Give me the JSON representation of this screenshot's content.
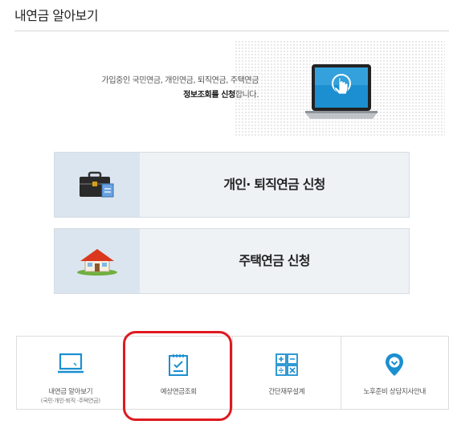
{
  "page": {
    "title": "내연금 알아보기"
  },
  "intro": {
    "line1": "가입중인 국민연금, 개인연금, 퇴직연금, 주택연금",
    "line2_bold": "정보조회를 신청",
    "line2_rest": "합니다."
  },
  "apply_buttons": [
    {
      "label": "개인· 퇴직연금 신청",
      "icon": "briefcase-icon"
    },
    {
      "label": "주택연금 신청",
      "icon": "house-icon"
    }
  ],
  "menu": [
    {
      "label": "내연금 알아보기",
      "sub": "(국민·개인·퇴직 ·주택연금)",
      "icon": "laptop-icon"
    },
    {
      "label": "예상연금조회",
      "sub": "",
      "icon": "checklist-icon"
    },
    {
      "label": "간단재무설계",
      "sub": "",
      "icon": "calculator-icon"
    },
    {
      "label": "노후준비 상담지사안내",
      "sub": "",
      "icon": "location-pin-icon"
    }
  ],
  "colors": {
    "accent": "#1b8fd0",
    "highlight": "#e0191f",
    "icon_box": "#dbe5ef"
  }
}
